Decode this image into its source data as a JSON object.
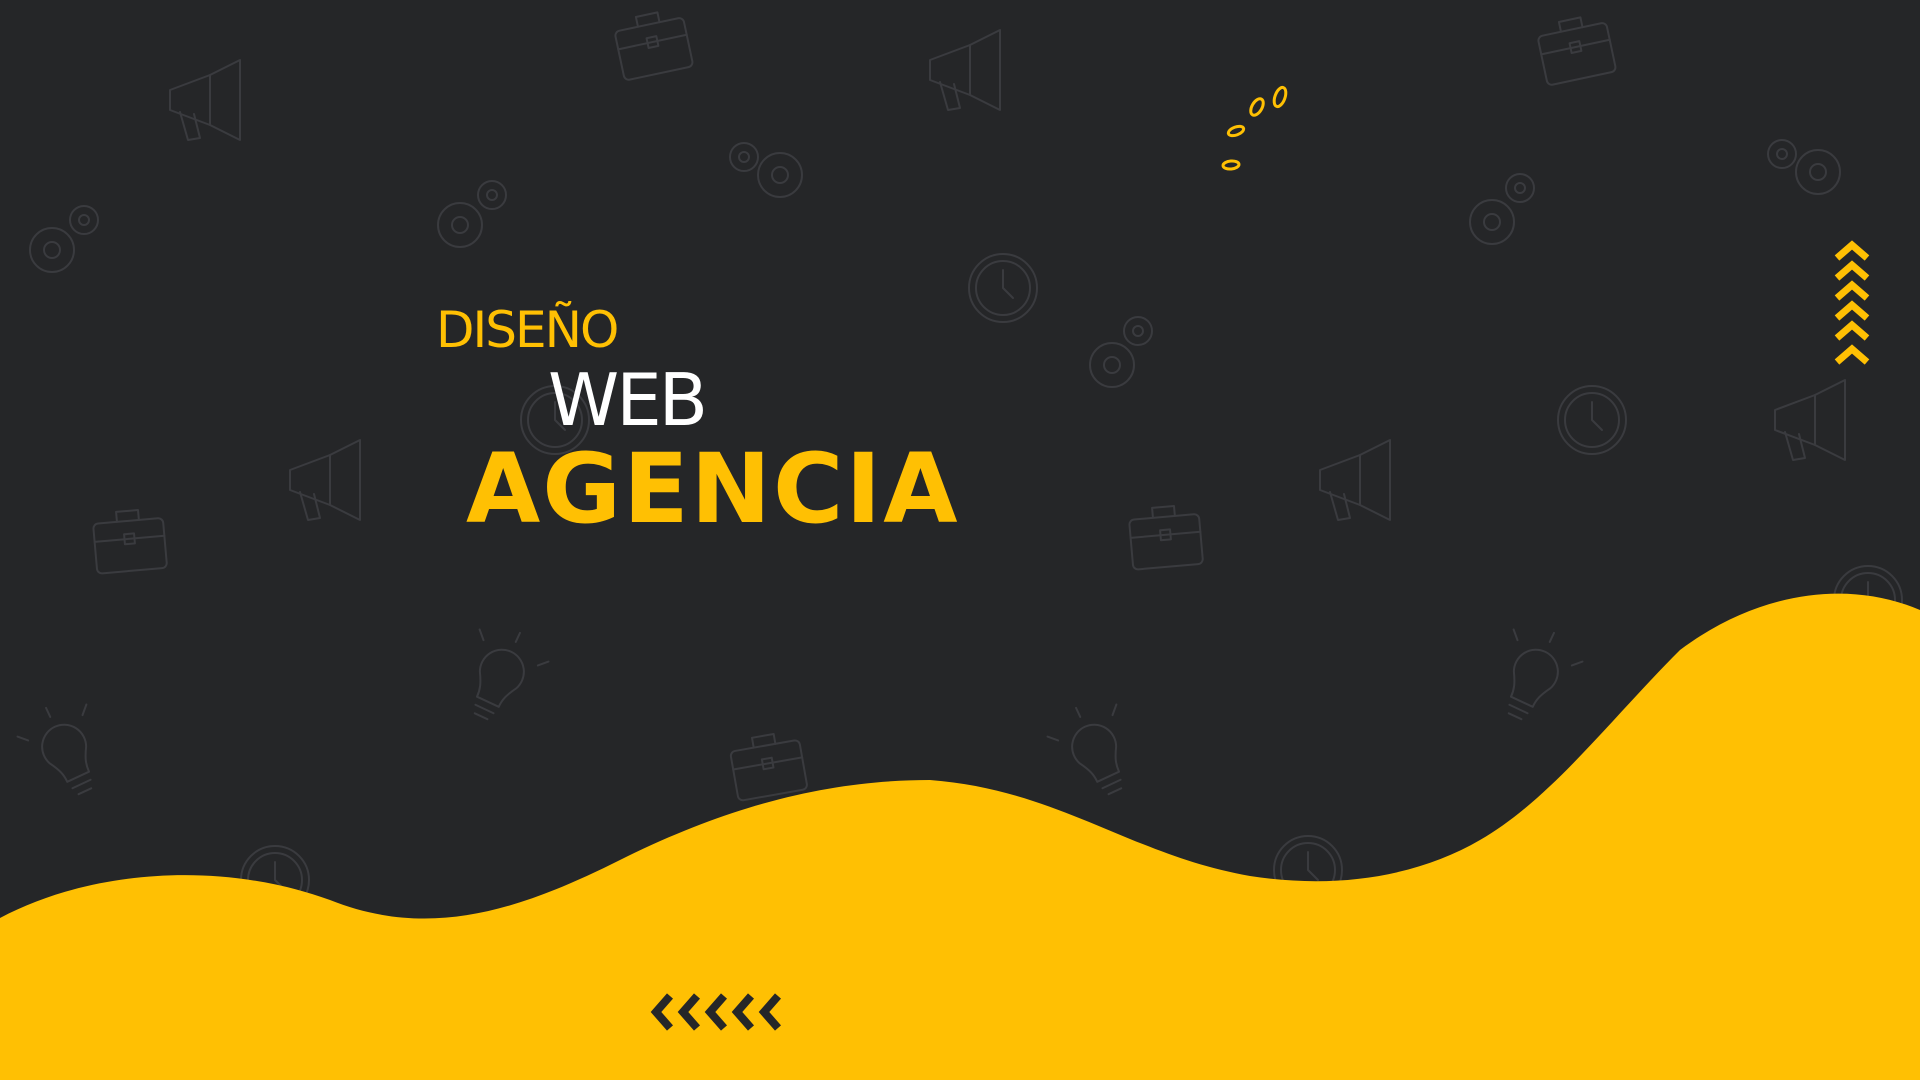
{
  "hero": {
    "line_1": "DISEÑO",
    "line_2": "WEB",
    "line_3": "AGENCIA"
  },
  "colors": {
    "background": "#252628",
    "accent": "#FFC003",
    "text_light": "#FFFFFF",
    "doodle": "#3a3b3f"
  },
  "decorations": {
    "chevrons_up_count": 5,
    "chevrons_left_count": 5,
    "doodle_icons": [
      "briefcase-icon",
      "megaphone-icon",
      "gear-icon",
      "clock-icon",
      "lightbulb-icon"
    ]
  }
}
